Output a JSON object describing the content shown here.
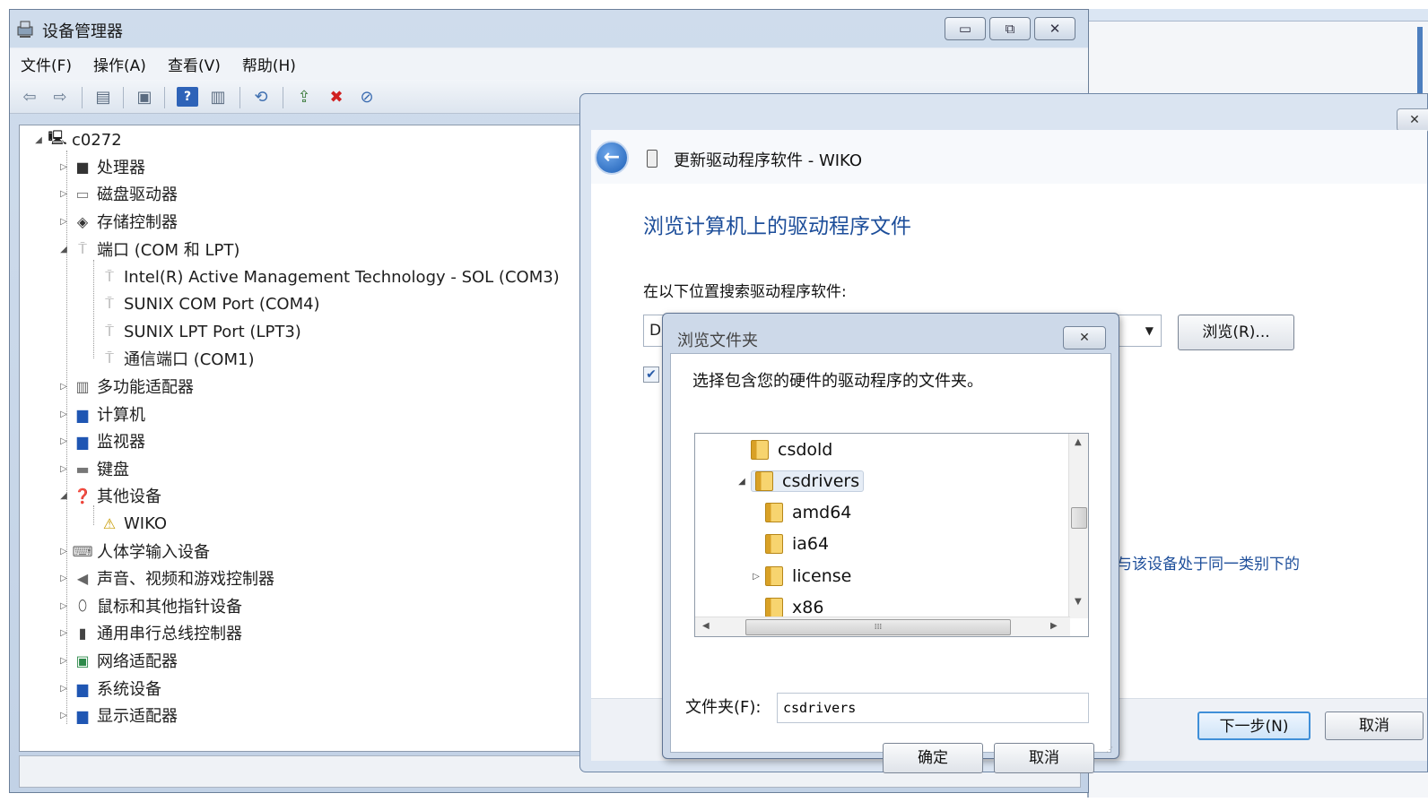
{
  "device_manager": {
    "title": "设备管理器",
    "window_buttons": {
      "minimize": "▭",
      "maximize": "⧉",
      "close": "✕"
    },
    "menu": [
      "文件(F)",
      "操作(A)",
      "查看(V)",
      "帮助(H)"
    ],
    "tree": {
      "root": "c0272",
      "items": [
        {
          "label": "处理器",
          "icon": "processor-icon"
        },
        {
          "label": "磁盘驱动器",
          "icon": "disk-drive-icon"
        },
        {
          "label": "存储控制器",
          "icon": "storage-controller-icon"
        },
        {
          "label": "端口 (COM 和 LPT)",
          "icon": "port-icon",
          "children": [
            "Intel(R) Active Management Technology - SOL (COM3)",
            "SUNIX COM Port (COM4)",
            "SUNIX LPT Port (LPT3)",
            "通信端口 (COM1)"
          ]
        },
        {
          "label": "多功能适配器",
          "icon": "multifunction-adapter-icon"
        },
        {
          "label": "计算机",
          "icon": "computer-icon"
        },
        {
          "label": "监视器",
          "icon": "monitor-icon"
        },
        {
          "label": "键盘",
          "icon": "keyboard-icon"
        },
        {
          "label": "其他设备",
          "icon": "other-devices-icon",
          "children": [
            "WIKO"
          ]
        },
        {
          "label": "人体学输入设备",
          "icon": "hid-icon"
        },
        {
          "label": "声音、视频和游戏控制器",
          "icon": "sound-icon"
        },
        {
          "label": "鼠标和其他指针设备",
          "icon": "mouse-icon"
        },
        {
          "label": "通用串行总线控制器",
          "icon": "usb-icon"
        },
        {
          "label": "网络适配器",
          "icon": "network-adapter-icon"
        },
        {
          "label": "系统设备",
          "icon": "system-devices-icon"
        },
        {
          "label": "显示适配器",
          "icon": "display-adapter-icon"
        }
      ]
    }
  },
  "wizard": {
    "close": "✕",
    "header_title": "更新驱动程序软件 - WIKO",
    "heading": "浏览计算机上的驱动程序文件",
    "search_label": "在以下位置搜索驱动程序软件:",
    "path_value": "D",
    "browse_button": "浏览(R)...",
    "include_subfolders_checked": true,
    "side_text": "与该设备处于同一类别下的",
    "next_button": "下一步(N)",
    "cancel_button": "取消"
  },
  "browse_dialog": {
    "title": "浏览文件夹",
    "close": "✕",
    "description": "选择包含您的硬件的驱动程序的文件夹。",
    "folders": [
      "csdold",
      "csdrivers",
      "amd64",
      "ia64",
      "license",
      "x86"
    ],
    "selected_folder": "csdrivers",
    "folder_label": "文件夹(F):",
    "folder_value": "csdrivers",
    "ok_button": "确定",
    "cancel_button": "取消"
  }
}
